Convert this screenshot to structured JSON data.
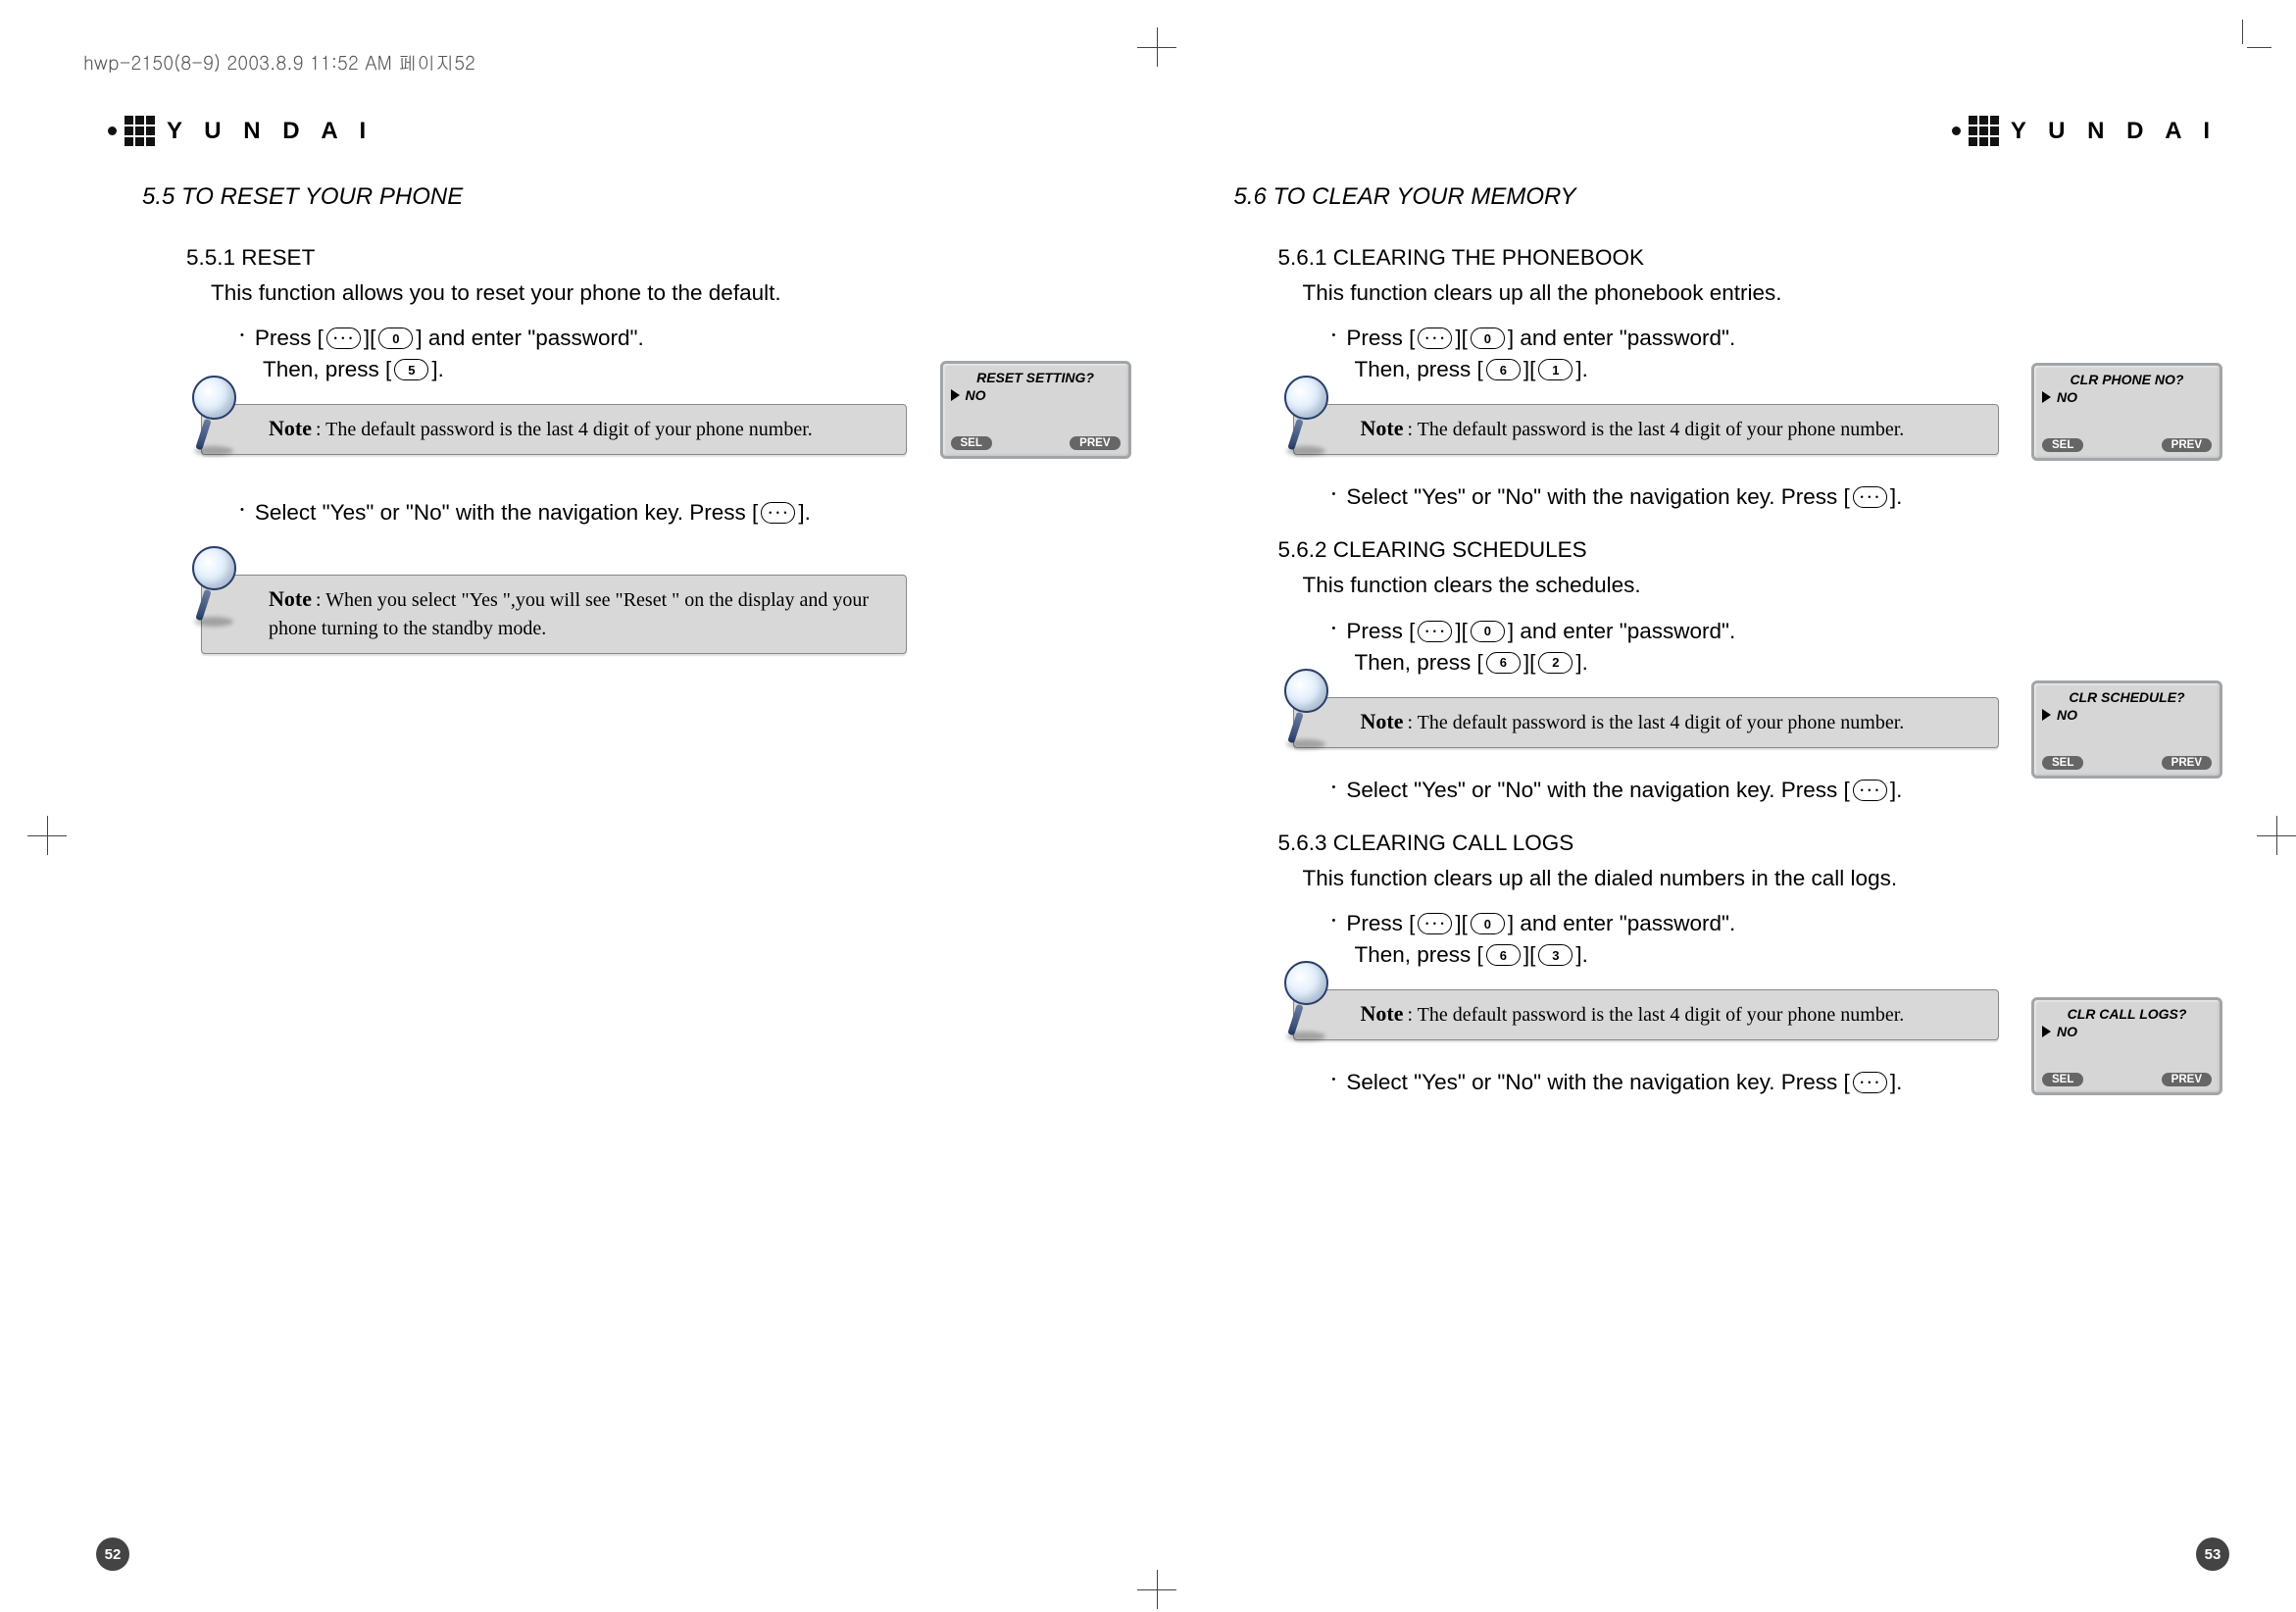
{
  "doc_header": "hwp-2150(8-9)  2003.8.9 11:52 AM  페이지52",
  "brand_text": "Y U N D A I",
  "left": {
    "section": "5.5 TO RESET YOUR PHONE",
    "s1_title": "5.5.1 RESET",
    "s1_desc": "This function allows you to reset your phone to the default.",
    "press_prefix": "Press [",
    "press_mid": "][",
    "press_suffix": "] and enter \"password\".",
    "then_prefix": "Then, press [",
    "then_suffix": "].",
    "note1": ": The default password is the last 4 digit of your phone number.",
    "select_line_pre": "Select \"Yes\" or \"No\" with the navigation key. Press [",
    "select_line_post": "].",
    "note2": ": When you select \"Yes \",you will see \"Reset \" on the display and your phone turning to the standby mode.",
    "screen": {
      "title": "RESET SETTING?",
      "option": "NO",
      "sel": "SEL",
      "prev": "PREV"
    },
    "page_num": "52",
    "key5": "5",
    "key0": "0"
  },
  "right": {
    "section": "5.6 TO CLEAR YOUR MEMORY",
    "note_default": ": The default password is the last 4 digit of your phone number.",
    "select_pre": "Select \"Yes\" or \"No\" with the navigation key. Press [",
    "select_post": "].",
    "press_prefix": "Press [",
    "press_mid": "][",
    "press_suffix": "] and enter \"password\".",
    "then_prefix": "Then, press [",
    "then_mid": "][",
    "then_suffix": "].",
    "key0": "0",
    "key1": "1",
    "key2": "2",
    "key3": "3",
    "key6": "6",
    "s1": {
      "title": "5.6.1 CLEARING THE PHONEBOOK",
      "desc": "This function clears up all the phonebook entries.",
      "screen": {
        "title": "CLR  PHONE NO?",
        "option": "NO",
        "sel": "SEL",
        "prev": "PREV"
      }
    },
    "s2": {
      "title": "5.6.2 CLEARING SCHEDULES",
      "desc": "This function clears the schedules.",
      "screen": {
        "title": "CLR SCHEDULE?",
        "option": "NO",
        "sel": "SEL",
        "prev": "PREV"
      }
    },
    "s3": {
      "title": "5.6.3 CLEARING CALL LOGS",
      "desc": "This function clears up all the dialed numbers in the call logs.",
      "screen": {
        "title": "CLR CALL LOGS?",
        "option": "NO",
        "sel": "SEL",
        "prev": "PREV"
      }
    },
    "page_num": "53"
  },
  "note_label": "Note"
}
